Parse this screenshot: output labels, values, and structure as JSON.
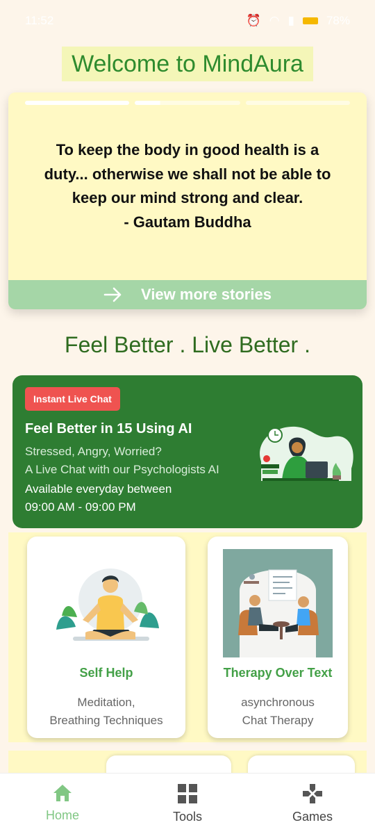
{
  "status": {
    "time": "11:52",
    "battery": "78%"
  },
  "header": {
    "title": "Welcome to MindAura"
  },
  "story": {
    "quote_lines": [
      "To keep the body in good health is a",
      "duty... otherwise we shall not be able to",
      "keep our mind strong and clear."
    ],
    "author": "- Gautam Buddha",
    "view_more": "View more stories"
  },
  "tagline": "Feel Better . Live Better .",
  "live_chat": {
    "badge": "Instant Live Chat",
    "title": "Feel Better in 15 Using AI",
    "lines": [
      "Stressed, Angry, Worried?",
      "A Live Chat with our Psychologists AI",
      "Available everyday between",
      "09:00 AM - 09:00 PM"
    ]
  },
  "features": [
    {
      "title": "Self Help",
      "subtitle_lines": [
        "Meditation,",
        "Breathing Techniques"
      ]
    },
    {
      "title": "Therapy Over Text",
      "subtitle_lines": [
        "asynchronous",
        "Chat Therapy"
      ]
    }
  ],
  "nav": [
    {
      "label": "Home",
      "icon": "home-icon"
    },
    {
      "label": "Tools",
      "icon": "grid-icon"
    },
    {
      "label": "Games",
      "icon": "gamepad-icon"
    }
  ],
  "colors": {
    "brand_green": "#2e7d32",
    "accent_green": "#43a047",
    "badge_red": "#ef5350",
    "story_bg": "#fff9c4",
    "page_bg": "#fdf5ea"
  }
}
